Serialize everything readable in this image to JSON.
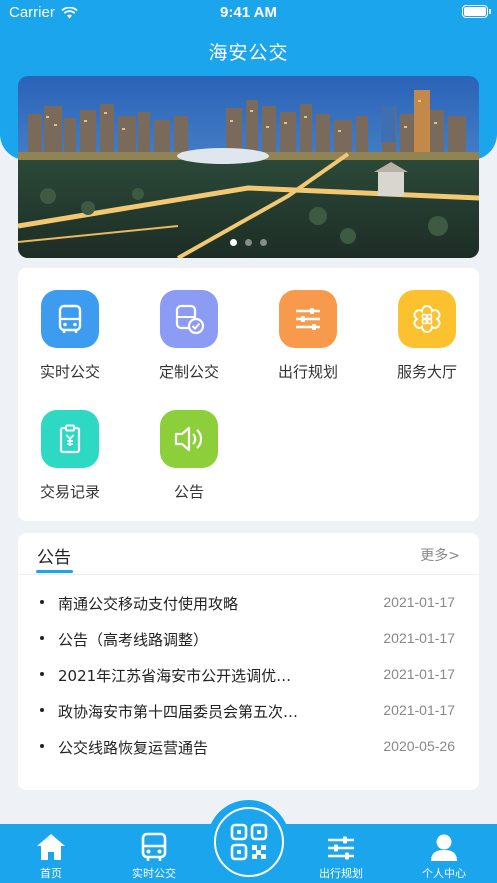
{
  "status_bar": {
    "carrier": "Carrier",
    "time": "9:41 AM"
  },
  "header": {
    "title": "海安公交"
  },
  "banner": {
    "slide_count": 3,
    "active_index": 0
  },
  "menu": [
    {
      "label": "实时公交",
      "icon": "bus-icon",
      "color": "#3d9cf0"
    },
    {
      "label": "定制公交",
      "icon": "custom-bus-icon",
      "color": "#8c9cf5"
    },
    {
      "label": "出行规划",
      "icon": "sliders-icon",
      "color": "#f89a4c"
    },
    {
      "label": "服务大厅",
      "icon": "flower-icon",
      "color": "#fcc12f"
    },
    {
      "label": "交易记录",
      "icon": "receipt-icon",
      "color": "#2ed9c3"
    },
    {
      "label": "公告",
      "icon": "speaker-icon",
      "color": "#8ccf3a"
    }
  ],
  "notices": {
    "title": "公告",
    "more": "更多>",
    "items": [
      {
        "text": "南通公交移动支付使用攻略",
        "date": "2021-01-17"
      },
      {
        "text": "公告（高考线路调整）",
        "date": "2021-01-17"
      },
      {
        "text": "2021年江苏省海安市公开选调优…",
        "date": "2021-01-17"
      },
      {
        "text": "政协海安市第十四届委员会第五次…",
        "date": "2021-01-17"
      },
      {
        "text": "公交线路恢复运营通告",
        "date": "2020-05-26"
      }
    ]
  },
  "tabbar": {
    "home": "首页",
    "realtime": "实时公交",
    "scan_icon": "qr-code-icon",
    "plan": "出行规划",
    "profile": "个人中心"
  },
  "colors": {
    "accent": "#1aa5ec",
    "background": "#eef1f5"
  }
}
